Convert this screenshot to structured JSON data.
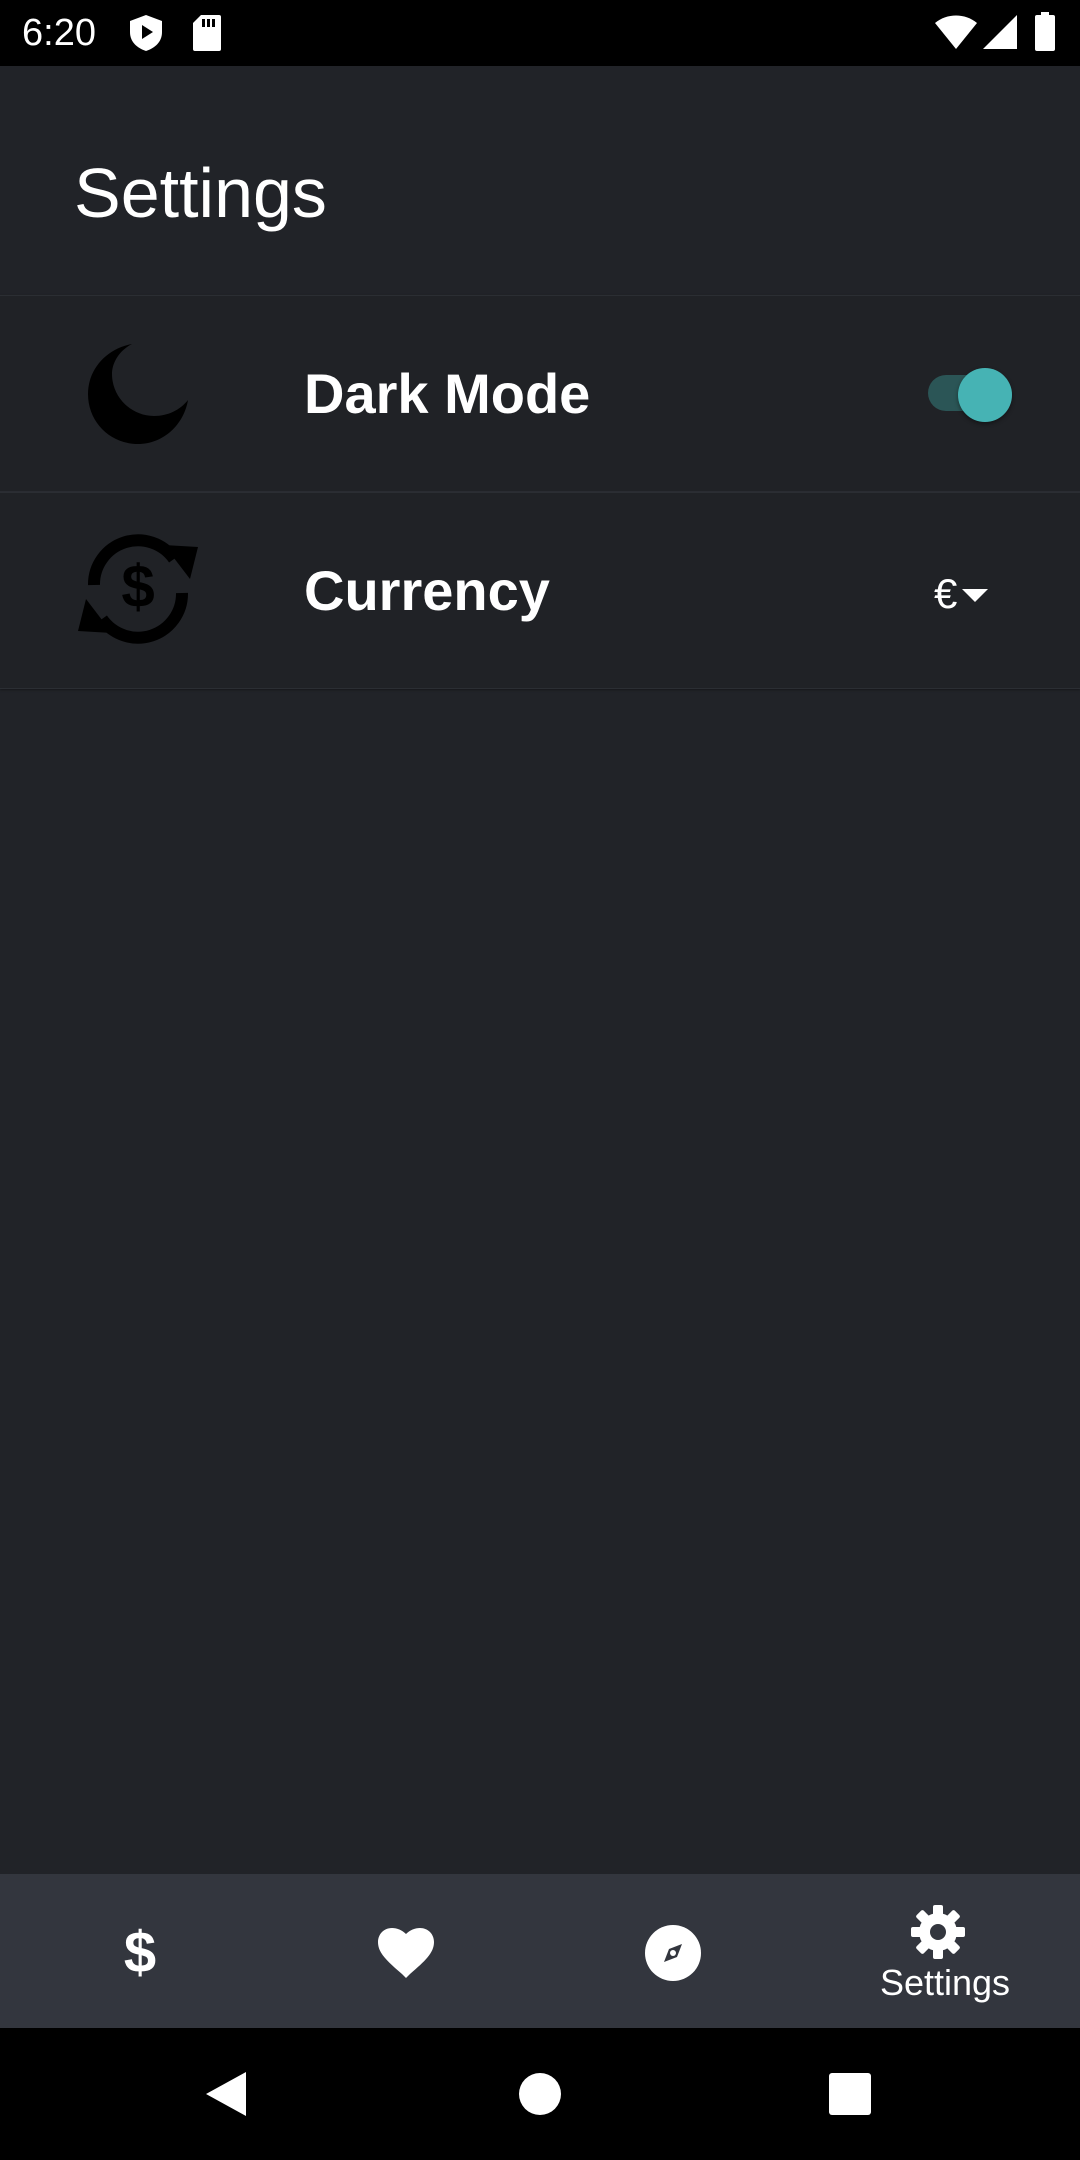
{
  "status_bar": {
    "time": "6:20",
    "icons": [
      "shield-icon",
      "sd-card-icon",
      "wifi-icon",
      "signal-icon",
      "battery-icon"
    ]
  },
  "page": {
    "title": "Settings"
  },
  "settings": {
    "dark_mode": {
      "label": "Dark Mode",
      "icon": "moon-icon",
      "enabled": true
    },
    "currency": {
      "label": "Currency",
      "icon": "currency-exchange-icon",
      "selected": "€"
    }
  },
  "bottom_nav": {
    "items": [
      {
        "icon": "dollar-icon",
        "label": ""
      },
      {
        "icon": "heart-icon",
        "label": ""
      },
      {
        "icon": "compass-icon",
        "label": ""
      },
      {
        "icon": "gear-icon",
        "label": "Settings",
        "active": true
      }
    ]
  },
  "system_nav": {
    "buttons": [
      "back-icon",
      "home-icon",
      "recents-icon"
    ]
  },
  "colors": {
    "background": "#212328",
    "accent": "#46b3b4",
    "nav_background": "#33363e"
  }
}
